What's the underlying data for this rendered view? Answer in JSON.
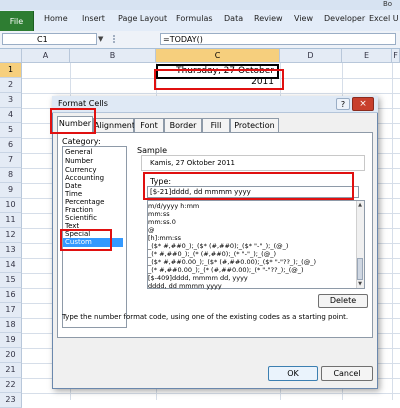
{
  "ribbon": {
    "file_tab": "File",
    "tabs": [
      "Home",
      "Insert",
      "Page Layout",
      "Formulas",
      "Data",
      "Review",
      "View",
      "Developer",
      "Excel U"
    ],
    "title_fragment": "Bo"
  },
  "formula_bar": {
    "name_box": "C1",
    "formula": "=TODAY()"
  },
  "sheet": {
    "columns": [
      "A",
      "B",
      "C",
      "D",
      "E",
      "F"
    ],
    "selected_column": "C",
    "rows": [
      "1",
      "2",
      "3",
      "4",
      "5",
      "6",
      "7",
      "8",
      "9",
      "10",
      "11",
      "12",
      "13",
      "14",
      "15",
      "16",
      "17",
      "18",
      "19",
      "20",
      "21",
      "22",
      "23"
    ],
    "selected_row": "1",
    "c1_value": "Thursday, 27 October 2011"
  },
  "dialog": {
    "title": "Format Cells",
    "help": "?",
    "close": "×",
    "tabs": [
      "Number",
      "Alignment",
      "Font",
      "Border",
      "Fill",
      "Protection"
    ],
    "active_tab": "Number",
    "category_label": "Category:",
    "categories": [
      "General",
      "Number",
      "Currency",
      "Accounting",
      "Date",
      "Time",
      "Percentage",
      "Fraction",
      "Scientific",
      "Text",
      "Special",
      "Custom"
    ],
    "selected_category": "Custom",
    "sample_label": "Sample",
    "sample_value": "Kamis, 27 Oktober 2011",
    "type_label": "Type:",
    "type_value": "[$-21]dddd, dd mmmm yyyy",
    "formats": [
      "m/d/yyyy h:mm",
      "mm:ss",
      "mm:ss.0",
      "@",
      "[h]:mm:ss",
      "_($* #,##0_);_($* (#,##0);_($* \"-\"_);_(@_)",
      "_(* #,##0_);_(* (#,##0);_(* \"-\"_);_(@_)",
      "_($* #,##0.00_);_($* (#,##0.00);_($* \"-\"??_);_(@_)",
      "_(* #,##0.00_);_(* (#,##0.00);_(* \"-\"??_);_(@_)",
      "[$-409]dddd, mmmm dd, yyyy",
      "dddd, dd mmmm yyyy"
    ],
    "delete_label": "Delete",
    "hint": "Type the number format code, using one of the existing codes as a starting point.",
    "ok_label": "OK",
    "cancel_label": "Cancel"
  },
  "colors": {
    "file_tab": "#2e7d32",
    "selection_highlight": "#3399ff",
    "header_selected": "#f6cf7d",
    "annotation_red": "#e01010"
  }
}
